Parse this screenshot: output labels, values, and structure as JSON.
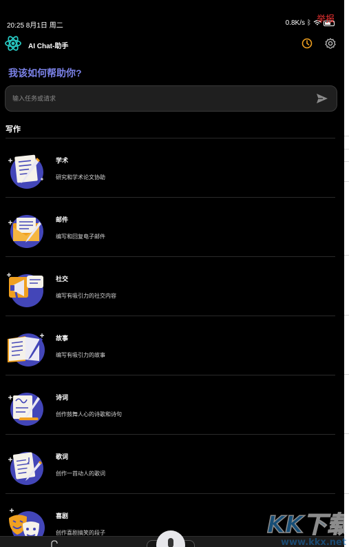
{
  "status_bar": {
    "time": "20:25 8月1日 周二",
    "network": "0.8K/s",
    "report_link": "举报"
  },
  "header": {
    "app_title": "AI Chat-助手",
    "history_icon": "clock-icon",
    "settings_icon": "gear-icon",
    "logo_icon": "atom-logo-icon"
  },
  "greeting": "我该如何帮助你?",
  "search": {
    "placeholder": "输入任务或请求",
    "send_icon": "send-icon"
  },
  "section": {
    "title": "写作"
  },
  "categories": [
    {
      "title": "学术",
      "desc": "研究和学术论文协助",
      "icon": "academic-paper-icon"
    },
    {
      "title": "邮件",
      "desc": "编写和回复电子邮件",
      "icon": "email-envelope-icon"
    },
    {
      "title": "社交",
      "desc": "编写有吸引力的社交内容",
      "icon": "megaphone-icon"
    },
    {
      "title": "故事",
      "desc": "编写有吸引力的故事",
      "icon": "book-icon"
    },
    {
      "title": "诗词",
      "desc": "创作鼓舞人心的诗歌和诗句",
      "icon": "poem-scroll-icon"
    },
    {
      "title": "歌词",
      "desc": "创作一首动人的歌词",
      "icon": "lyrics-sheet-icon"
    },
    {
      "title": "喜剧",
      "desc": "创作喜剧搞笑的段子",
      "icon": "comedy-masks-icon"
    }
  ],
  "watermark": {
    "brand": "KK下载",
    "url": "www.kkx.net"
  },
  "colors": {
    "accent": "#7b82e8",
    "history_icon": "#f0a020",
    "report": "#e33333",
    "background": "#000000"
  }
}
